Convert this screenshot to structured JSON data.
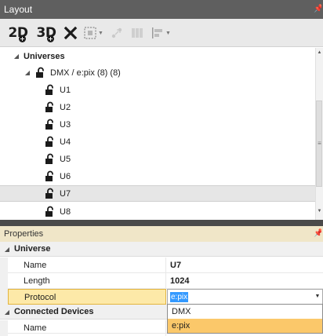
{
  "layout_panel": {
    "title": "Layout",
    "toolbar": {
      "view2d_label": "2D",
      "view3d_label": "3D"
    },
    "tree": [
      {
        "label": "Universes",
        "expanded": true,
        "bold": true
      },
      {
        "label": "DMX / e:pix (8) (8)",
        "expanded": true
      },
      {
        "label": "U1"
      },
      {
        "label": "U2"
      },
      {
        "label": "U3"
      },
      {
        "label": "U4"
      },
      {
        "label": "U5"
      },
      {
        "label": "U6"
      },
      {
        "label": "U7",
        "selected": true
      },
      {
        "label": "U8"
      }
    ]
  },
  "properties_panel": {
    "title": "Properties",
    "categories": {
      "universe": "Universe",
      "connected_devices": "Connected Devices"
    },
    "rows": {
      "name": {
        "label": "Name",
        "value": "U7"
      },
      "length": {
        "label": "Length",
        "value": "1024"
      },
      "protocol": {
        "label": "Protocol",
        "value": "e:pix"
      },
      "devices_name": {
        "label": "Name"
      }
    },
    "protocol_options": [
      "DMX",
      "e:pix"
    ],
    "protocol_highlighted": "e:pix"
  },
  "colors": {
    "title_bar": "#5f5f5f",
    "selection": "#3399ff",
    "dropdown_highlight": "#fbc86a",
    "active_property": "#fde9a8"
  }
}
